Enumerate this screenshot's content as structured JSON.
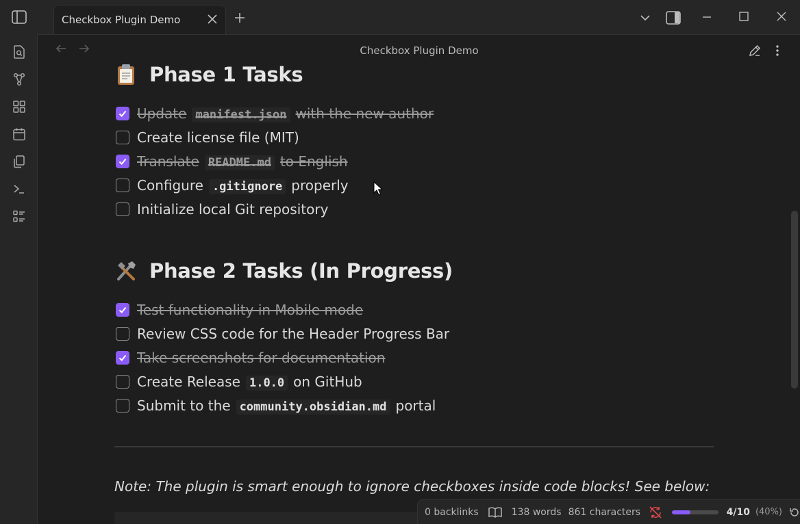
{
  "window": {
    "tab_title": "Checkbox Plugin Demo",
    "view_title": "Checkbox Plugin Demo"
  },
  "phase1": {
    "title": "Phase 1 Tasks",
    "emoji": "clipboard-icon",
    "tasks": [
      {
        "done": true,
        "before": "Update",
        "code": "manifest.json",
        "after": "with the new author"
      },
      {
        "done": false,
        "before": "Create license file (MIT)",
        "code": "",
        "after": ""
      },
      {
        "done": true,
        "before": "Translate",
        "code": "README.md",
        "after": "to English"
      },
      {
        "done": false,
        "before": "Configure",
        "code": ".gitignore",
        "after": "properly"
      },
      {
        "done": false,
        "before": "Initialize local Git repository",
        "code": "",
        "after": ""
      }
    ]
  },
  "phase2": {
    "title": "Phase 2 Tasks (In Progress)",
    "emoji": "hammer-and-wrench-icon",
    "tasks": [
      {
        "done": true,
        "before": "Test functionality in Mobile mode",
        "code": "",
        "after": ""
      },
      {
        "done": false,
        "before": "Review CSS code for the Header Progress Bar",
        "code": "",
        "after": ""
      },
      {
        "done": true,
        "before": "Take screenshots for documentation",
        "code": "",
        "after": ""
      },
      {
        "done": false,
        "before": "Create Release",
        "code": "1.0.0",
        "after": "on GitHub"
      },
      {
        "done": false,
        "before": "Submit to the",
        "code": "community.obsidian.md",
        "after": "portal"
      }
    ]
  },
  "note": "Note: The plugin is smart enough to ignore checkboxes inside code blocks! See below:",
  "statusbar": {
    "backlinks": "0 backlinks",
    "words": "138 words",
    "characters": "861 characters",
    "progress_ratio": "4/10",
    "progress_percent": "(40%)",
    "progress_value": 0.4
  },
  "colors": {
    "accent": "#8a5cf5",
    "background": "#1e1e1e",
    "sync_error": "#e5484d"
  }
}
